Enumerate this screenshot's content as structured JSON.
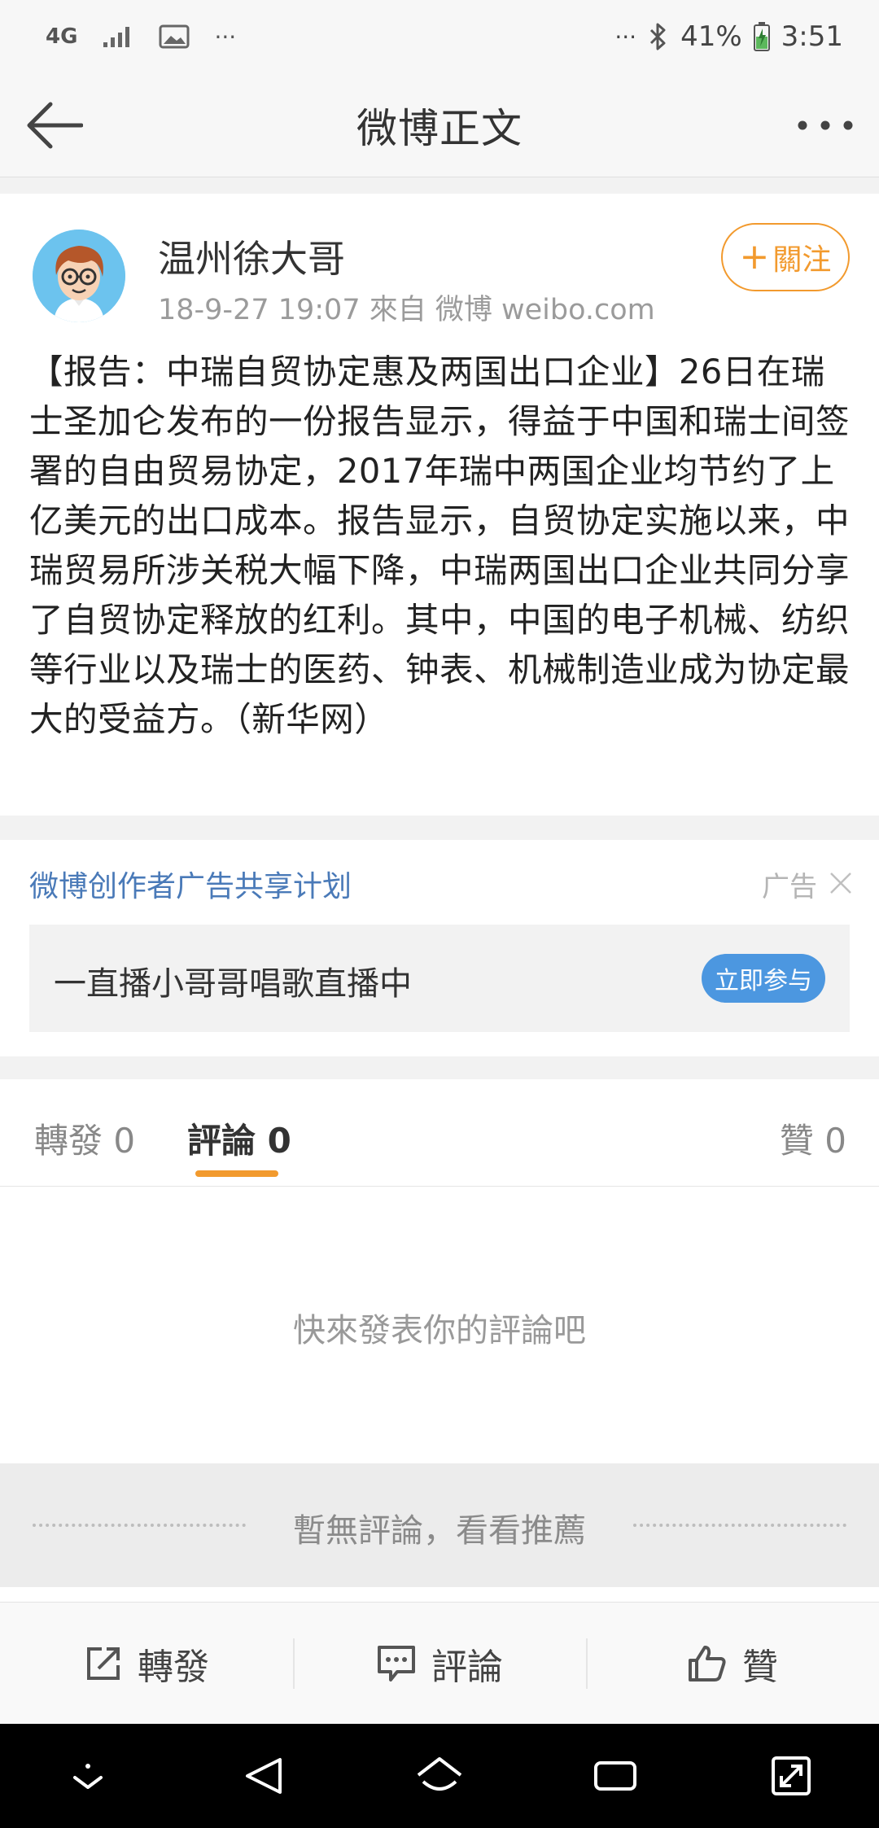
{
  "status_bar": {
    "network": "4G",
    "overflow": "···",
    "right_overflow": "···",
    "battery": "41%",
    "time": "3:51",
    "icons": [
      "signal-icon",
      "image-icon",
      "bluetooth-icon",
      "battery-icon"
    ]
  },
  "header": {
    "title": "微博正文",
    "back_icon": "back-arrow-icon",
    "more_icon": "more-dots-icon"
  },
  "post": {
    "author": "温州徐大哥",
    "meta": "18-9-27 19:07   來自 微博 weibo.com",
    "follow_label": "關注",
    "follow_plus": "+",
    "text": "【报告：中瑞自贸协定惠及两国出口企业】26日在瑞士圣加仑发布的一份报告显示，得益于中国和瑞士间签署的自由贸易协定，2017年瑞中两国企业均节约了上亿美元的出口成本。报告显示，自贸协定实施以来，中瑞贸易所涉关税大幅下降，中瑞两国出口企业共同分享了自贸协定释放的红利。其中，中国的电子机械、纺织等行业以及瑞士的医药、钟表、机械制造业成为协定最大的受益方。（新华网）"
  },
  "ad": {
    "title": "微博创作者广告共享计划",
    "label": "广告",
    "text": "一直播小哥哥唱歌直播中",
    "button": "立即参与"
  },
  "tabs": {
    "repost": "轉發 0",
    "comment": "評論 0",
    "like": "贊 0"
  },
  "empty_state": "快來發表你的評論吧",
  "recommend_divider": "暫無評論，看看推薦",
  "action_bar": {
    "repost": "轉發",
    "comment": "評論",
    "like": "贊"
  },
  "colors": {
    "accent": "#f29a2e",
    "link": "#4a7ab8",
    "ad_button": "#4c97e0"
  }
}
